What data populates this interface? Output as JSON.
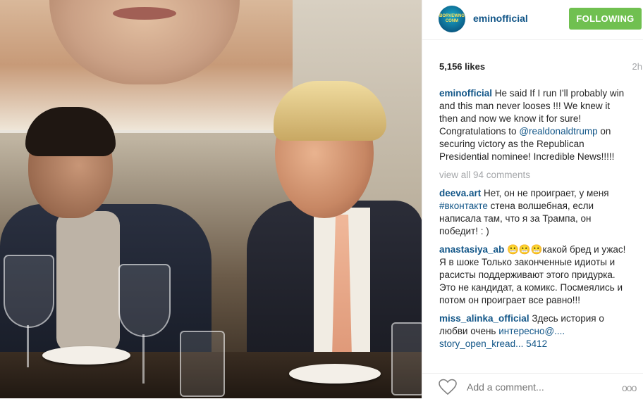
{
  "post": {
    "username": "eminofficial",
    "avatar_text": "BORVEWNG\nCONM",
    "follow_label": "FOLLOWING",
    "likes": "5,156 likes",
    "time": "2h",
    "caption_user": "eminofficial",
    "caption_1": " He said If I run I'll probably win and this man never looses !!! We knew it then and now we know it for sure! Congratulations to ",
    "caption_mention": "@realdonaldtrump",
    "caption_2": " on securing victory as the Republican Presidential nominee! Incredible News!!!!!",
    "view_all": "view all 94 comments",
    "comments": [
      {
        "user": "deeva.art",
        "pre": " Нет, он не проиграет, у меня ",
        "tag": "#вконтакте",
        "post": " стена волшебная, если написала там, что я за Трампа, он победит! : )"
      },
      {
        "user": "anastasiya_ab",
        "pre": " 😬😬😬какой бред и ужас! Я в шоке Только законченные идиоты и расисты поддерживают этого придурка. Это не кандидат, а комикс. Посмеялись и потом он проиграет все равно!!!",
        "tag": "",
        "post": ""
      },
      {
        "user": "miss_alinka_official",
        "pre": " Здесь история о любви очень ",
        "tag": "интересно@.... story_open_kread... 5412",
        "post": ""
      }
    ]
  },
  "footer": {
    "add_comment_placeholder": "Add a comment...",
    "more_label": "ooo",
    "heart_icon": "heart-outline-icon"
  }
}
